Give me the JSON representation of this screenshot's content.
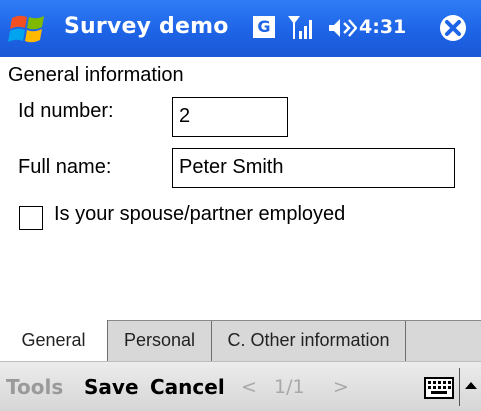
{
  "titlebar": {
    "title": "Survey demo",
    "g_icon_label": "G",
    "time": "4:31",
    "icons": [
      "windows-start-icon",
      "g-icon",
      "signal-icon",
      "volume-icon",
      "close-icon"
    ]
  },
  "form": {
    "section_title": "General information",
    "id_label": "Id number:",
    "id_value": "2",
    "name_label": "Full name:",
    "name_value": "Peter Smith",
    "spouse_label": "Is your spouse/partner employed",
    "spouse_checked": false
  },
  "tabs": [
    {
      "label": "General",
      "active": true
    },
    {
      "label": "Personal",
      "active": false
    },
    {
      "label": "C. Other information",
      "active": false
    }
  ],
  "menubar": {
    "tools": "Tools",
    "save": "Save",
    "cancel": "Cancel",
    "prev": "<",
    "page": "1/1",
    "next": ">",
    "icons": [
      "keyboard-icon",
      "sip-up-arrow-icon"
    ]
  },
  "colors": {
    "titlebar": "#1d64e6",
    "title_text": "#ffffff",
    "tab_strip": "#d8d8d8",
    "menubar": "#dcdcdc",
    "disabled_text": "#9a9a9a"
  }
}
